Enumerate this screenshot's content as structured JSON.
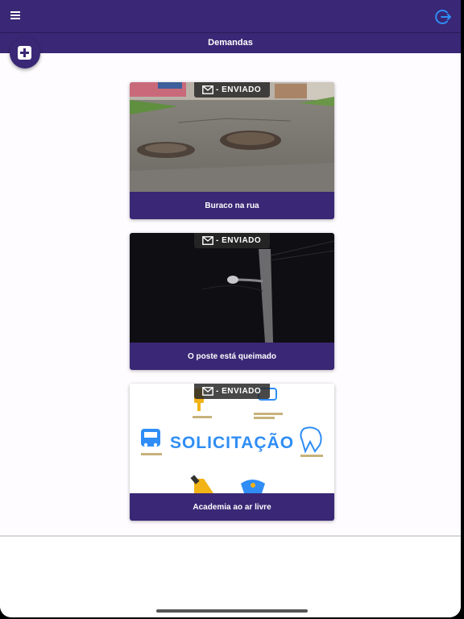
{
  "header": {
    "menu_icon": "menu-icon",
    "logout_icon": "logout-icon",
    "accent_color": "#3a2775",
    "logout_color": "#2f8df5"
  },
  "subheader": {
    "title": "Demandas"
  },
  "fab": {
    "icon": "add-icon"
  },
  "cards": [
    {
      "title": "Buraco na rua",
      "status": "- ENVIADO",
      "status_icon": "mail-icon"
    },
    {
      "title": "O poste está queimado",
      "status": "- ENVIADO",
      "status_icon": "mail-icon"
    },
    {
      "title": "Academia ao ar livre",
      "status": "- ENVIADO",
      "status_icon": "mail-icon",
      "image_text": "SOLICITAÇÃO"
    }
  ]
}
